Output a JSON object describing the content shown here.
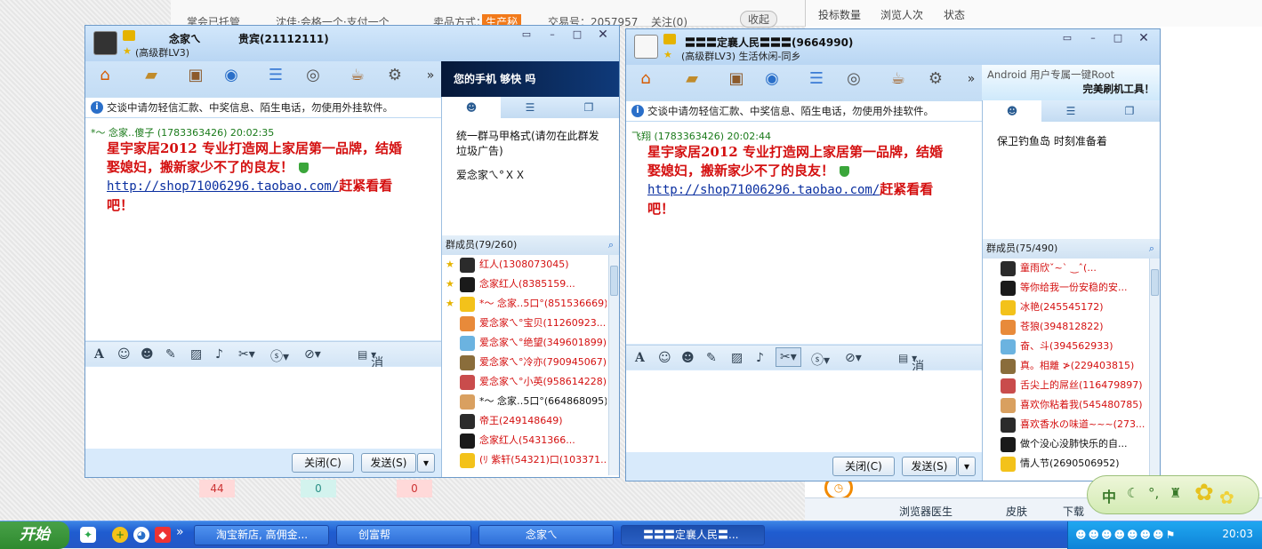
{
  "web": {
    "top_text": [
      "掌会已托管",
      "沈佳·会格一个·支付一个",
      "卖品方式：",
      "生产秘",
      "交易号：2057957",
      "关注(0)",
      "收起"
    ],
    "tabs": [
      "投标数量",
      "浏览人次",
      "状态"
    ],
    "counts": [
      "44",
      "0",
      "0"
    ],
    "bottom_bar": [
      "浏览器医生",
      "皮肤",
      "下载"
    ]
  },
  "win1": {
    "name": "念家ㄟ",
    "tag": "贵宾(21112111)",
    "level": "(高级群LV3)",
    "ad": "您的手机 够快 吗",
    "notice": "交谈中请勿轻信汇款、中奖信息、陌生电话，勿使用外挂软件。",
    "sender": "*～ 念家‥傻子 (1783363426)  20:02:35",
    "message_line1": "星宇家居2012 专业打造网上家居第一品牌，结婚",
    "message_line2": "娶媳妇，搬新家少不了的良友！",
    "message_link": "http://shop71006296.taobao.com/",
    "message_tail": "赶紧看看",
    "message_end": "吧！",
    "history_label": "消息记录",
    "close_label": "关闭(C)",
    "send_label": "发送(S)",
    "announcement": [
      "统一群马甲格式(请勿在此群发",
      "垃圾广告)",
      "",
      "爱念家ㄟ°ＸＸ"
    ],
    "members_header": "群成员(79/260)",
    "members": [
      {
        "name": "红人(1308073045)",
        "color": "#d41010"
      },
      {
        "name": "念家红人(8385159...",
        "color": "#d41010"
      },
      {
        "name": "*～ 念家‥5口°(851536669)",
        "color": "#d41010"
      },
      {
        "name": "爱念家ㄟ°宝贝(11260923...",
        "color": "#d41010"
      },
      {
        "name": "爱念家ㄟ°绝望(349601899)",
        "color": "#d41010"
      },
      {
        "name": "爱念家ㄟ°冷亦(790945067)",
        "color": "#d41010"
      },
      {
        "name": "爱念家ㄟ°小英(958614228)",
        "color": "#d41010"
      },
      {
        "name": "*～ 念家‥5口°(664868095)",
        "color": "#111111"
      },
      {
        "name": "帝王(249148649)",
        "color": "#d41010"
      },
      {
        "name": "念家红人(5431366...",
        "color": "#d41010"
      },
      {
        "name": "(ﾘ 紫轩(54321)口(103371...",
        "color": "#d41010"
      }
    ]
  },
  "win2": {
    "name": "〓〓〓定襄人民〓〓〓(9664990)",
    "level": "(高级群LV3) 生活休闲-同乡",
    "ad_line1": "Android 用户专属一键Root",
    "ad_line2": "完美刷机工具！",
    "notice": "交谈中请勿轻信汇款、中奖信息、陌生电话，勿使用外挂软件。",
    "sender": "飞翔 (1783363426)  20:02:44",
    "message_line1": "星宇家居2012 专业打造网上家居第一品牌，结婚",
    "message_line2": "娶媳妇，搬新家少不了的良友！",
    "message_link": "http://shop71006296.taobao.com/",
    "message_tail": "赶紧看看",
    "message_end": "吧！",
    "history_label": "消息记录",
    "close_label": "关闭(C)",
    "send_label": "发送(S)",
    "announcement": [
      "保卫钓鱼岛  时刻准备着"
    ],
    "members_header": "群成员(75/490)",
    "members": [
      {
        "name": "童雨欣ˇ~ˋ  ‿ˆ(...",
        "color": "#d41010"
      },
      {
        "name": "等你给我一份安稳的安...",
        "color": "#d41010"
      },
      {
        "name": "冰艳(245545172)",
        "color": "#d41010"
      },
      {
        "name": "苍狼(394812822)",
        "color": "#d41010"
      },
      {
        "name": "奋、斗(394562933)",
        "color": "#d41010"
      },
      {
        "name": "真。相離 ≯(229403815)",
        "color": "#d41010"
      },
      {
        "name": "舌尖上的屌丝(116479897)",
        "color": "#d41010"
      },
      {
        "name": "喜欢你粘着我(545480785)",
        "color": "#d41010"
      },
      {
        "name": "喜欢香水の味道~~~(273...",
        "color": "#d41010"
      },
      {
        "name": "做个没心没肺快乐的自...",
        "color": "#111111"
      },
      {
        "name": "情人节(2690506952)",
        "color": "#111111"
      }
    ]
  },
  "ime": {
    "label": "中"
  },
  "taskbar": {
    "start": "开始",
    "items": [
      "淘宝新店, 高佣金...",
      "创富帮",
      "念家ㄟ",
      "〓〓〓定襄人民〓..."
    ],
    "clock": "20:03"
  }
}
